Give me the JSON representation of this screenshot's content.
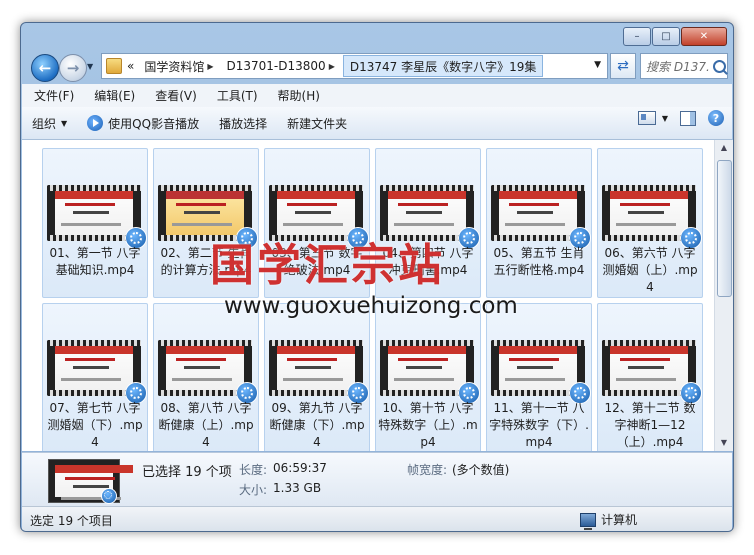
{
  "window": {
    "min_glyph": "–",
    "max_glyph": "□",
    "close_glyph": "✕"
  },
  "address": {
    "root_chevron": "«",
    "crumbs": [
      "国学资料馆",
      "D13701-D13800"
    ],
    "current": "D13747 李星辰《数字八字》19集",
    "search_placeholder": "搜索 D137..."
  },
  "menu": [
    "文件(F)",
    "编辑(E)",
    "查看(V)",
    "工具(T)",
    "帮助(H)"
  ],
  "toolbar": {
    "organize": "组织",
    "qq_play": "使用QQ影音播放",
    "play_selection": "播放选择",
    "new_folder": "新建文件夹",
    "help": "?"
  },
  "files": [
    "01、第一节 八字基础知识.mp4",
    "02、第二节 生肖的计算方法.mp4",
    "03、第三节 数字绝破法.mp4",
    "04、第四节 八字冲克刑害.mp4",
    "05、第五节 生肖五行断性格.mp4",
    "06、第六节 八字测婚姻（上）.mp4",
    "07、第七节 八字测婚姻（下）.mp4",
    "08、第八节 八字断健康（上）.mp4",
    "09、第九节 八字断健康（下）.mp4",
    "10、第十节 八字特殊数字（上）.mp4",
    "11、第十一节 八字特殊数字（下）.mp4",
    "12、第十二节 数字神断1—12（上）.mp4"
  ],
  "details": {
    "selected": "已选择 19 个项",
    "length_label": "长度:",
    "length_value": "06:59:37",
    "size_label": "大小:",
    "size_value": "1.33 GB",
    "frame_width_label": "帧宽度:",
    "frame_width_value": "(多个数值)"
  },
  "status": {
    "left": "选定 19 个项目",
    "right": "计算机"
  },
  "watermark": {
    "cn": "国学汇宗站",
    "url": "www.guoxuehuizong.com"
  }
}
